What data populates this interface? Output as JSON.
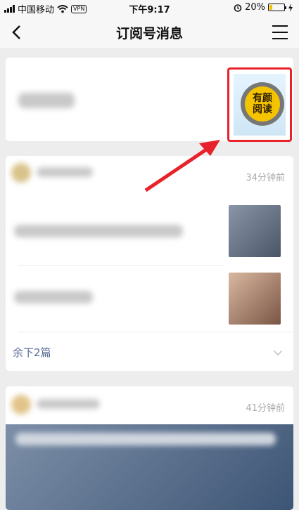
{
  "status_bar": {
    "carrier": "中国移动",
    "vpn": "VPN",
    "time": "下午9:17",
    "battery_percent": "20%",
    "battery_level": 0.2
  },
  "nav": {
    "title": "订阅号消息",
    "back_icon": "chevron-left-icon",
    "menu_icon": "hamburger-menu-icon"
  },
  "promo": {
    "badge_line1": "有颜",
    "badge_line2": "阅读",
    "highlight_color": "#e8222b"
  },
  "cards": [
    {
      "time": "34分钟前",
      "more_label": "余下2篇"
    },
    {
      "time": "41分钟前"
    }
  ]
}
